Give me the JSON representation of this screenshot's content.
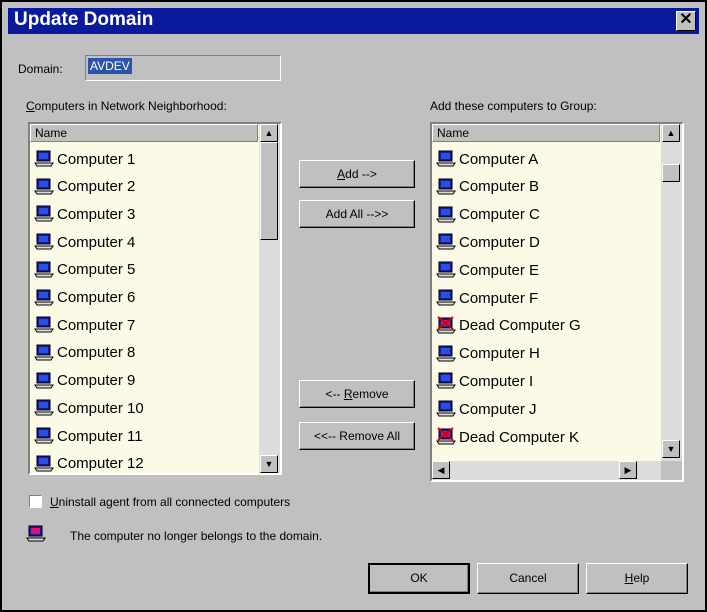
{
  "dialog": {
    "title": "Update Domain",
    "close_icon": "close-icon"
  },
  "domain": {
    "label": "Domain:",
    "value": "AVDEV"
  },
  "left": {
    "label": "Computers in Network Neighborhood:",
    "header": "Name",
    "items": [
      "Computer 1",
      "Computer 2",
      "Computer 3",
      "Computer 4",
      "Computer 5",
      "Computer 6",
      "Computer 7",
      "Computer 8",
      "Computer 9",
      "Computer 10",
      "Computer 11",
      "Computer 12"
    ]
  },
  "right": {
    "label": "Add these computers to Group:",
    "header": "Name",
    "items": [
      {
        "label": "Computer A",
        "dead": false
      },
      {
        "label": "Computer B",
        "dead": false
      },
      {
        "label": "Computer C",
        "dead": false
      },
      {
        "label": "Computer D",
        "dead": false
      },
      {
        "label": "Computer E",
        "dead": false
      },
      {
        "label": "Computer F",
        "dead": false
      },
      {
        "label": "Dead Computer G",
        "dead": true
      },
      {
        "label": "Computer H",
        "dead": false
      },
      {
        "label": "Computer I",
        "dead": false
      },
      {
        "label": "Computer J",
        "dead": false
      },
      {
        "label": "Dead Computer K",
        "dead": true
      }
    ]
  },
  "buttons": {
    "add": "Add -->",
    "add_all": "Add All -->>",
    "remove": "<-- Remove",
    "remove_all": "<<-- Remove All",
    "ok": "OK",
    "cancel": "Cancel",
    "help": "Help"
  },
  "uninstall": {
    "label": "Uninstall agent from all connected computers",
    "checked": false
  },
  "legend": {
    "text": "The computer no longer belongs to the domain."
  },
  "colors": {
    "title_bar": "#0a1a9c",
    "list_bg": "#fafae6",
    "dialog_bg": "#c0c0c0"
  }
}
